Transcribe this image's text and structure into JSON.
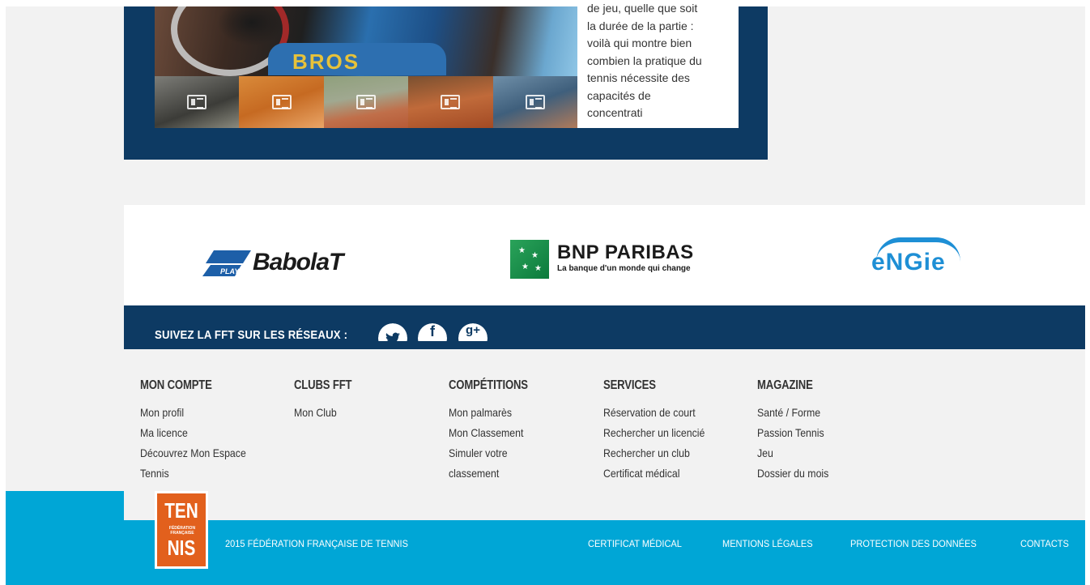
{
  "article": {
    "text_lines": [
      "de jeu, quelle que soit",
      "la durée de la partie :",
      "voilà qui montre bien",
      "combien la pratique du",
      "tennis nécessite des",
      "capacités de",
      "concentrati"
    ],
    "hero_brand_text": "BROS",
    "thumbnails": [
      "photo-1",
      "photo-2",
      "photo-3",
      "photo-4",
      "photo-5"
    ]
  },
  "sponsors": {
    "babolat": {
      "play": "PLAY",
      "name": "BabolaT"
    },
    "bnp": {
      "name": "BNP PARIBAS",
      "tagline": "La banque d'un monde qui change"
    },
    "engie": {
      "name": "eNGie"
    }
  },
  "social": {
    "label": "SUIVEZ LA FFT SUR LES RÉSEAUX :",
    "twitter_glyph": "🐦",
    "facebook_glyph": "f",
    "googleplus_glyph": "g+"
  },
  "footer": {
    "columns": [
      {
        "title": "MON COMPTE",
        "links": [
          "Mon profil",
          "Ma licence",
          "Découvrez Mon Espace",
          "Tennis"
        ]
      },
      {
        "title": "CLUBS FFT",
        "links": [
          "Mon Club"
        ]
      },
      {
        "title": "COMPÉTITIONS",
        "links": [
          "Mon palmarès",
          "Mon Classement",
          "Simuler votre",
          "classement"
        ]
      },
      {
        "title": "SERVICES",
        "links": [
          "Réservation de court",
          "Rechercher un licencié",
          "Rechercher un club",
          "Certificat médical"
        ]
      },
      {
        "title": "MAGAZINE",
        "links": [
          "Santé / Forme",
          "Passion Tennis",
          "Jeu",
          "Dossier du mois"
        ]
      }
    ]
  },
  "bottom": {
    "logo": {
      "line1": "TEN",
      "middle": "FÉDÉRATION FRANÇAISE",
      "line2": "NIS"
    },
    "copyright": "2015 FÉDÉRATION FRANÇAISE DE TENNIS",
    "links": [
      "CERTIFICAT MÉDICAL",
      "MENTIONS LÉGALES",
      "PROTECTION DES DONNÉES",
      "CONTACTS"
    ]
  },
  "colors": {
    "navy": "#0d3a63",
    "cyan": "#00a6d6",
    "orange": "#e2601d",
    "engie": "#1e8fd5"
  }
}
